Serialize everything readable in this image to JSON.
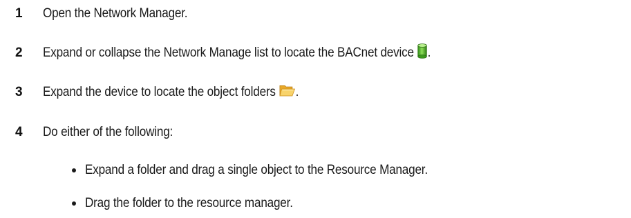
{
  "steps": [
    {
      "number": "1",
      "text": "Open the Network Manager."
    },
    {
      "number": "2",
      "text": "Expand or collapse the Network Manage list to locate the BACnet device",
      "suffix": ".",
      "icon": "device-cylinder-icon"
    },
    {
      "number": "3",
      "text": "Expand the device to locate the object folders",
      "suffix": ".",
      "icon": "open-folder-icon"
    },
    {
      "number": "4",
      "text": "Do either of the following:"
    }
  ],
  "bullets": [
    {
      "text": "Expand a folder and drag a single object to the Resource Manager."
    },
    {
      "text": "Drag the folder to the resource manager."
    }
  ],
  "colors": {
    "device_icon": "#4caf2a",
    "folder_icon": "#f2c14e"
  }
}
